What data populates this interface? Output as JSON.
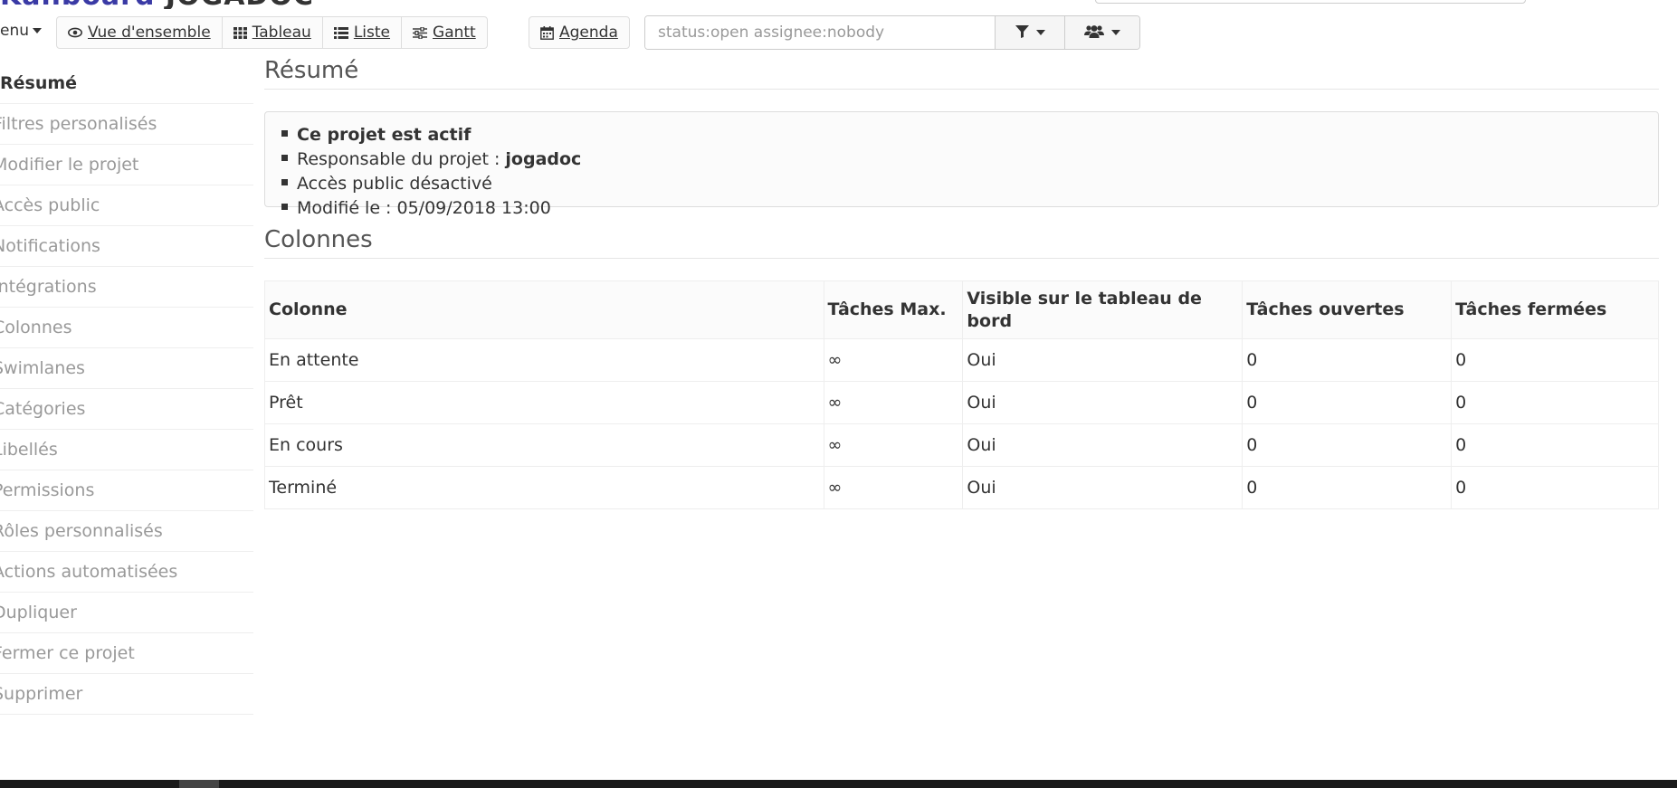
{
  "header": {
    "logo_part1": "Kanboard",
    "logo_part2": "",
    "project_name": "JOGADOC"
  },
  "toolbar": {
    "menu_label": "enu",
    "views": [
      {
        "label": "Vue d'ensemble",
        "icon": "eye-icon"
      },
      {
        "label": "Tableau",
        "icon": "grid-icon"
      },
      {
        "label": "Liste",
        "icon": "list-icon"
      },
      {
        "label": "Gantt",
        "icon": "sliders-icon"
      }
    ],
    "agenda_label": "Agenda",
    "filter_value": "status:open assignee:nobody"
  },
  "sidebar": {
    "items": [
      {
        "label": "Résumé",
        "active": true
      },
      {
        "label": "Filtres personalisés"
      },
      {
        "label": "Modifier le projet"
      },
      {
        "label": "Accès public"
      },
      {
        "label": "Notifications"
      },
      {
        "label": "Intégrations"
      },
      {
        "label": "Colonnes"
      },
      {
        "label": "Swimlanes"
      },
      {
        "label": "Catégories"
      },
      {
        "label": "Libellés"
      },
      {
        "label": "Permissions"
      },
      {
        "label": "Rôles personnalisés"
      },
      {
        "label": "Actions automatisées"
      },
      {
        "label": "Dupliquer"
      },
      {
        "label": "Fermer ce projet"
      },
      {
        "label": "Supprimer"
      }
    ]
  },
  "summary": {
    "title": "Résumé",
    "active_text": "Ce projet est actif",
    "owner_label": "Responsable du projet : ",
    "owner_value": "jogadoc",
    "public_access": "Accès public désactivé",
    "modified": "Modifié le : 05/09/2018 13:00"
  },
  "columns": {
    "title": "Colonnes",
    "headers": [
      "Colonne",
      "Tâches Max.",
      "Visible sur le tableau de bord",
      "Tâches ouvertes",
      "Tâches fermées"
    ],
    "rows": [
      [
        "En attente",
        "∞",
        "Oui",
        "0",
        "0"
      ],
      [
        "Prêt",
        "∞",
        "Oui",
        "0",
        "0"
      ],
      [
        "En cours",
        "∞",
        "Oui",
        "0",
        "0"
      ],
      [
        "Terminé",
        "∞",
        "Oui",
        "0",
        "0"
      ]
    ]
  }
}
